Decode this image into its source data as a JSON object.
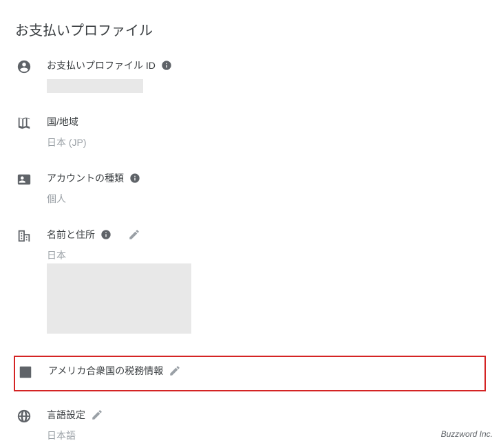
{
  "page_title": "お支払いプロファイル",
  "sections": {
    "profile_id": {
      "label": "お支払いプロファイル ID"
    },
    "country": {
      "label": "国/地域",
      "value": "日本 (JP)"
    },
    "account_type": {
      "label": "アカウントの種類",
      "value": "個人"
    },
    "name_address": {
      "label": "名前と住所",
      "country_line": "日本"
    },
    "tax_info": {
      "label": "アメリカ合衆国の税務情報"
    },
    "language": {
      "label": "言語設定",
      "value": "日本語"
    }
  },
  "footer": "Buzzword Inc."
}
